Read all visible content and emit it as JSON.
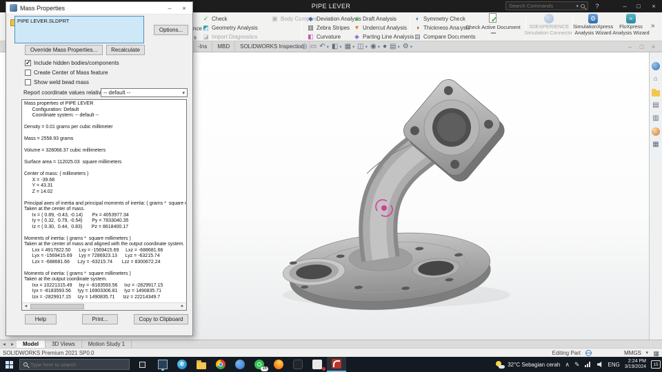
{
  "titlebar": {
    "title": "PIPE LEVER",
    "search_placeholder": "Search Commands"
  },
  "icons": {
    "caret": "▾",
    "help": "?",
    "minimize": "–",
    "maximize": "□",
    "close": "×",
    "overflow": "»",
    "left_arrow": "◂",
    "right_arrow": "▸",
    "checkmark": "✓",
    "edge": "e",
    "home": "⌂",
    "page": "▤",
    "grid": "▦",
    "palette": "▥",
    "chevron_up": "∧",
    "pen": "✎",
    "ribbon": {
      "check": "✓",
      "geometry": "◩",
      "import_diag": "◪",
      "body_compare": "▣",
      "deviation": "◆",
      "zebra": "▥",
      "curvature": "◧",
      "draft": "▲",
      "undercut": "▼",
      "parting": "◈",
      "symmetry": "◐",
      "thickness": "◑",
      "compare_docs": "▤",
      "gear": "⚙",
      "flow": "≈"
    },
    "headsup": [
      "◎",
      "▭",
      "↶",
      "◧",
      "▦",
      "◫",
      "◉",
      "●",
      "▤",
      "⚙"
    ]
  },
  "ribbon": {
    "clipped_label_1": "nce",
    "clipped_label_2": "s",
    "items": {
      "check": "Check",
      "geometry_analysis": "Geometry Analysis",
      "import_diagnostics": "Import Diagnostics",
      "body_compare": "Body Compare",
      "deviation_analysis": "Deviation Analysis",
      "zebra_stripes": "Zebra Stripes",
      "curvature": "Curvature",
      "draft_analysis": "Draft Analysis",
      "undercut_analysis": "Undercut Analysis",
      "parting_line_analysis": "Parting Line Analysis",
      "symmetry_check": "Symmetry Check",
      "thickness_analysis": "Thickness Analysis",
      "compare_documents": "Compare Documents",
      "check_active_document": "Check Active Document",
      "threedexperience_1": "3DEXPERIENCE",
      "threedexperience_2": "Simulation Connector",
      "simulationxpress_1": "SimulationXpress",
      "simulationxpress_2": "Analysis Wizard",
      "floxpress_1": "FloXpress",
      "floxpress_2": "Analysis Wizard"
    }
  },
  "command_tabs": {
    "addins": "-Ins",
    "mbd": "MBD",
    "inspection": "SOLIDWORKS Inspection"
  },
  "dialog": {
    "title": "Mass Properties",
    "filename": "PIPE LEVER.SLDPRT",
    "options": "Options...",
    "override": "Override Mass Properties...",
    "recalculate": "Recalculate",
    "cb_hidden": "Include hidden bodies/components",
    "cb_com": "Create Center of Mass feature",
    "cb_weld": "Show weld bead mass",
    "relative_label": "Report coordinate values relative to:",
    "relative_value": "-- default --",
    "report_lines": [
      "Mass properties of PIPE LEVER",
      "      Configuration: Default",
      "      Coordinate system: -- default --",
      "",
      "Density = 0.01 grams per cubic millimeter",
      "",
      "Mass = 2558.93 grams",
      "",
      "Volume = 328068.37 cubic millimeters",
      "",
      "Surface area = 112025.03  square millimeters",
      "",
      "Center of mass: ( millimeters )",
      "      X = -39.68",
      "      Y = 43.31",
      "      Z = 14.02",
      "",
      "Principal axes of inertia and principal moments of inertia: ( grams *  square millimeters )",
      "Taken at the center of mass.",
      "      Ix = ( 0.89, -0.43, -0.14)       Px = 4053977.34",
      "      Iy = ( 0.32,  0.79, -0.54)       Py = 7833040.35",
      "      Iz = ( 0.30,  0.44,  0.83)       Pz = 8618400.17",
      "",
      "Moments of inertia: ( grams *  square millimeters )",
      "Taken at the center of mass and aligned with the output coordinate system.",
      "      Lxx = 4917822.50      Lxy = -1569415.69     Lxz = -688681.66",
      "      Lyx = -1569415.69     Lyy = 7286923.13      Lyz = -63215.74",
      "      Lzx = -688681.66      Lzy = -63215.74       Lzz = 8300672.24",
      "",
      "Moments of inertia: ( grams *  square millimeters )",
      "Taken at the output coordinate system.",
      "      Ixx = 10221315.49     Ixy = -8183593.56     Ixz = -2829917.15",
      "      Iyx = -8183593.56     Iyy = 16903306.81     Iyz = 1490835.71",
      "      Izx = -2829917.15     Izy = 1490835.71      Izz = 22214349.7"
    ],
    "help": "Help",
    "print": "Print...",
    "copy": "Copy to Clipboard"
  },
  "doc_tabs": {
    "model": "Model",
    "views": "3D Views",
    "motion": "Motion Study 1"
  },
  "statusbar": {
    "product": "SOLIDWORKS Premium 2021 SP0.0",
    "mode": "Editing Part",
    "units": "MMGS"
  },
  "taskbar": {
    "search_placeholder": "Type here to search",
    "weather": "32°C Sebagian cerah",
    "language": "ENG",
    "time": "2:24 PM",
    "date": "3/19/2024",
    "whatsapp_badge": "16",
    "notification_badge": "15"
  },
  "colors": {
    "accent_blue": "#2f7fc1",
    "selection_fill": "#cfe8f7",
    "com_marker_pink": "#d63b9e",
    "model_gray": "#a8a8a8",
    "taskbar_bg": "#141a21",
    "whatsapp_green": "#2fbf4e",
    "firefox_orange": "#ff7a1a",
    "edge_blue": "#1a6fc4",
    "folder_yellow": "#f4c64e",
    "solidworks_red": "#b5342b",
    "check_green": "#2f9e3f"
  }
}
